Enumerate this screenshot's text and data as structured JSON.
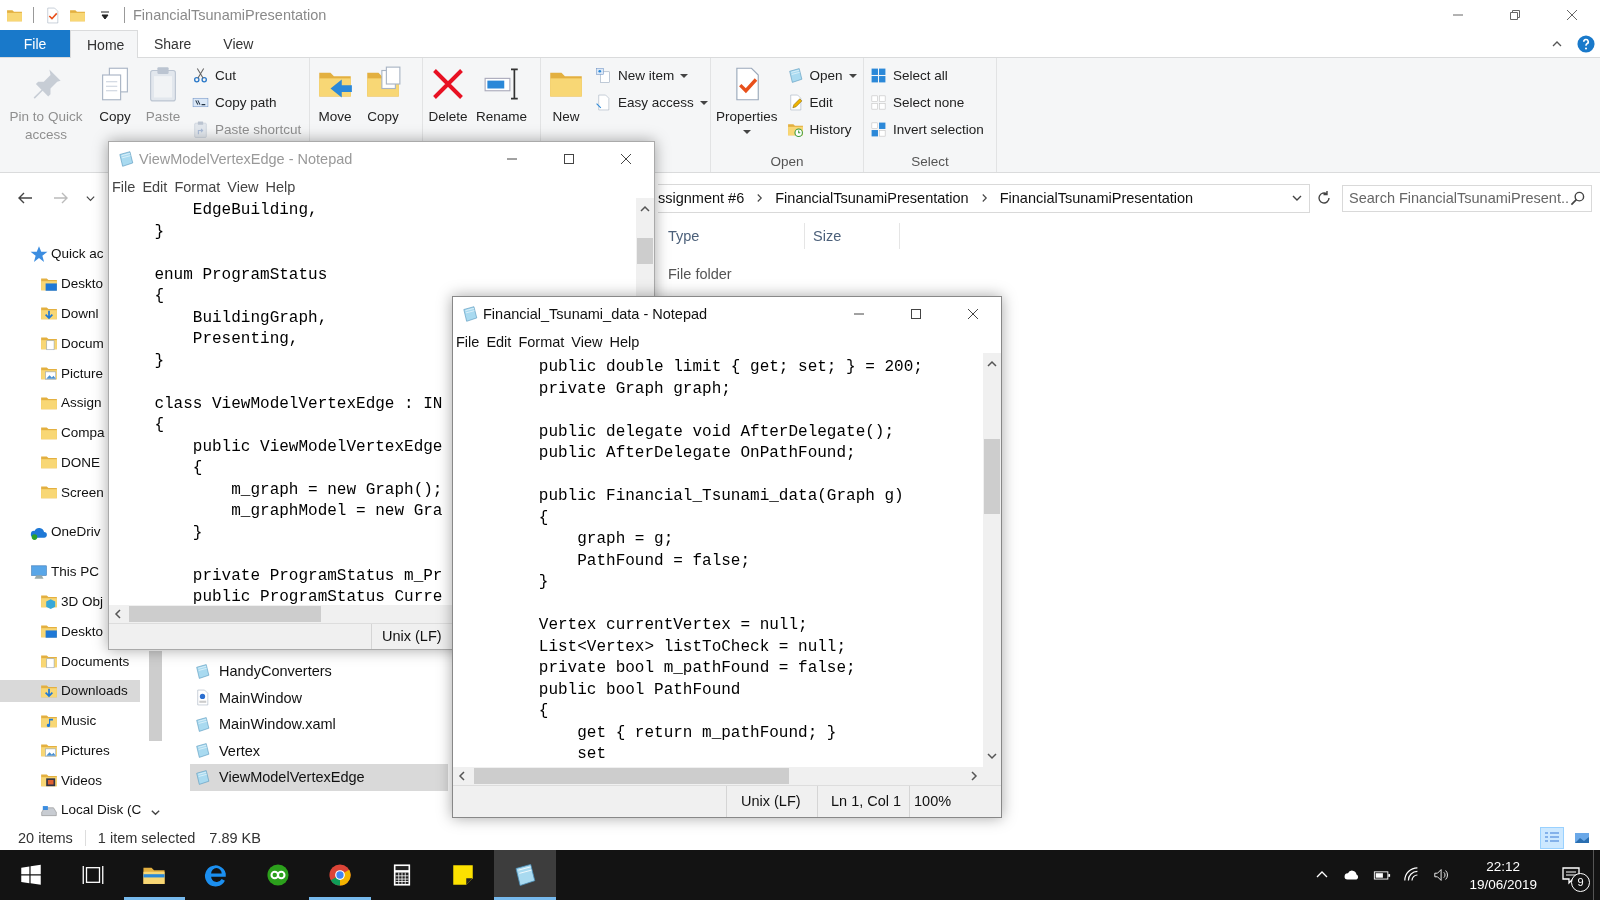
{
  "explorer": {
    "title": "FinancialTsunamiPresentation",
    "ribbon_tabs": [
      {
        "label": "File",
        "kind": "file",
        "selected": false
      },
      {
        "label": "Home",
        "kind": "tab",
        "selected": true
      },
      {
        "label": "Share",
        "kind": "tab",
        "selected": false
      },
      {
        "label": "View",
        "kind": "tab",
        "selected": false
      }
    ],
    "ribbon_groups": [
      {
        "large": [
          {
            "label": "Pin to Quick access",
            "kind": "pin",
            "disabled": true,
            "dropdown": false
          },
          {
            "label": "Copy",
            "kind": "copy",
            "disabled": false,
            "dropdown": false
          },
          {
            "label": "Paste",
            "kind": "paste",
            "disabled": true,
            "dropdown": false
          }
        ],
        "small": [
          {
            "label": "Cut",
            "kind": "cut",
            "disabled": false,
            "dropdown": false
          },
          {
            "label": "Copy path",
            "kind": "copy-path",
            "disabled": false,
            "dropdown": false
          },
          {
            "label": "Paste shortcut",
            "kind": "paste-shortcut",
            "disabled": true,
            "dropdown": false
          }
        ]
      },
      {
        "large": [
          {
            "label": "Move",
            "kind": "move",
            "disabled": false,
            "dropdown": false
          },
          {
            "label": "Copy",
            "kind": "copy-to",
            "disabled": false,
            "dropdown": false
          }
        ]
      },
      {
        "large": [
          {
            "label": "Delete",
            "kind": "delete",
            "disabled": false,
            "dropdown": false
          },
          {
            "label": "Rename",
            "kind": "rename",
            "disabled": false,
            "dropdown": false
          }
        ]
      },
      {
        "large": [
          {
            "label": "New",
            "kind": "new-folder",
            "disabled": false,
            "dropdown": false
          }
        ],
        "small": [
          {
            "label": "New item",
            "kind": "new-item",
            "disabled": false,
            "dropdown": true
          },
          {
            "label": "Easy access",
            "kind": "easy-access",
            "disabled": false,
            "dropdown": true
          }
        ]
      },
      {
        "label": "Open",
        "large": [
          {
            "label": "Properties",
            "kind": "properties",
            "disabled": false,
            "dropdown": true
          }
        ],
        "small": [
          {
            "label": "Open",
            "kind": "open",
            "disabled": false,
            "dropdown": true
          },
          {
            "label": "Edit",
            "kind": "edit",
            "disabled": false,
            "dropdown": false
          },
          {
            "label": "History",
            "kind": "history",
            "disabled": false,
            "dropdown": false
          }
        ]
      },
      {
        "label": "Select",
        "small": [
          {
            "label": "Select all",
            "kind": "select-all",
            "disabled": false,
            "dropdown": false
          },
          {
            "label": "Select none",
            "kind": "select-none",
            "disabled": false,
            "dropdown": false
          },
          {
            "label": "Invert selection",
            "kind": "invert-selection",
            "disabled": false,
            "dropdown": false
          }
        ]
      }
    ],
    "breadcrumb": [
      "ssignment #6",
      "FinancialTsunamiPresentation",
      "FinancialTsunamiPresentation"
    ],
    "search": {
      "placeholder": "Search FinancialTsunamiPresent..."
    },
    "nav_items": [
      {
        "label": "Quick ac",
        "kind": "star",
        "selected": false,
        "children": [
          {
            "label": "Deskto",
            "kind": "desktop",
            "selected": false
          },
          {
            "label": "Downl",
            "kind": "downloads",
            "selected": false
          },
          {
            "label": "Docum",
            "kind": "documents",
            "selected": false
          },
          {
            "label": "Picture",
            "kind": "pictures",
            "selected": false
          },
          {
            "label": "Assign",
            "kind": "folder",
            "selected": false
          },
          {
            "label": "Compa",
            "kind": "folder",
            "selected": false
          },
          {
            "label": "DONE",
            "kind": "folder",
            "selected": false
          },
          {
            "label": "Screen",
            "kind": "folder",
            "selected": false
          }
        ]
      },
      {
        "label": "OneDriv",
        "kind": "cloud",
        "selected": false
      },
      {
        "label": "This PC",
        "kind": "pc",
        "selected": false,
        "children": [
          {
            "label": "3D Obj",
            "kind": "cube",
            "selected": false
          },
          {
            "label": "Deskto",
            "kind": "desktop",
            "selected": false
          },
          {
            "label": "Documents",
            "kind": "documents",
            "selected": false
          },
          {
            "label": "Downloads",
            "kind": "downloads",
            "selected": true
          },
          {
            "label": "Music",
            "kind": "music",
            "selected": false
          },
          {
            "label": "Pictures",
            "kind": "pictures",
            "selected": false
          },
          {
            "label": "Videos",
            "kind": "videos",
            "selected": false
          },
          {
            "label": "Local Disk (C",
            "kind": "disk",
            "selected": false
          }
        ]
      }
    ],
    "file_list": {
      "columns": [
        "Type",
        "Size"
      ],
      "rows_top": [
        {
          "type": "File folder"
        }
      ],
      "rows_bottom": [
        {
          "name": "HandyConverters",
          "kind": "cs",
          "selected": false
        },
        {
          "name": "MainWindow",
          "kind": "xaml",
          "selected": false
        },
        {
          "name": "MainWindow.xaml",
          "kind": "cs",
          "selected": false
        },
        {
          "name": "Vertex",
          "kind": "cs",
          "selected": false
        },
        {
          "name": "ViewModelVertexEdge",
          "kind": "cs",
          "selected": true
        }
      ]
    },
    "status_bar": {
      "count": "20 items",
      "selection": "1 item selected",
      "size": "7.89 KB"
    },
    "view_buttons": [
      {
        "kind": "details",
        "selected": true
      },
      {
        "kind": "thumbnails",
        "selected": false
      }
    ]
  },
  "notepads": [
    {
      "title": "ViewModelVertexEdge - Notepad",
      "active": false,
      "menu": [
        "File",
        "Edit",
        "Format",
        "View",
        "Help"
      ],
      "code": "        EdgeBuilding,\n    }\n\n    enum ProgramStatus\n    {\n        BuildingGraph,\n        Presenting,\n    }\n\n    class ViewModelVertexEdge : IN\n    {\n        public ViewModelVertexEdge\n        {\n            m_graph = new Graph();\n            m_graphModel = new Gra\n        }\n\n        private ProgramStatus m_Pr\n        public ProgramStatus Curre",
      "status": [
        "Unix (LF)"
      ]
    },
    {
      "title": "Financial_Tsunami_data - Notepad",
      "active": true,
      "menu": [
        "File",
        "Edit",
        "Format",
        "View",
        "Help"
      ],
      "code": "        public double limit { get; set; } = 200;\n        private Graph graph;\n\n        public delegate void AfterDelegate();\n        public AfterDelegate OnPathFound;\n\n        public Financial_Tsunami_data(Graph g)\n        {\n            graph = g;\n            PathFound = false;\n        }\n\n        Vertex currentVertex = null;\n        List<Vertex> listToCheck = null;\n        private bool m_pathFound = false;\n        public bool PathFound\n        {\n            get { return m_pathFound; }\n            set",
      "status": [
        "Unix (LF)",
        "Ln 1, Col 1",
        "100%"
      ]
    }
  ],
  "taskbar": {
    "apps": [
      {
        "kind": "start",
        "running": false,
        "selected": false
      },
      {
        "kind": "task-view",
        "running": false,
        "selected": false
      },
      {
        "kind": "explorer",
        "running": true,
        "selected": false
      },
      {
        "kind": "edge",
        "running": false,
        "selected": false
      },
      {
        "kind": "quickbooks",
        "running": false,
        "selected": false
      },
      {
        "kind": "chrome",
        "running": true,
        "selected": false
      },
      {
        "kind": "calculator",
        "running": false,
        "selected": false
      },
      {
        "kind": "sticky",
        "running": false,
        "selected": false
      },
      {
        "kind": "notepad",
        "running": true,
        "selected": true
      }
    ],
    "time": "22:12",
    "date": "19/06/2019",
    "notifications": "9"
  }
}
